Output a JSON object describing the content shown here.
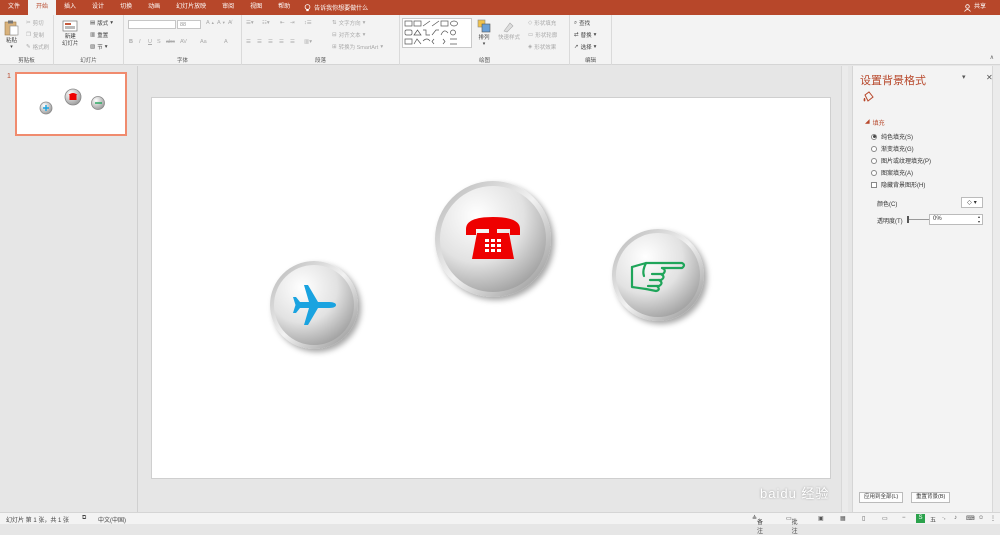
{
  "tabs": [
    {
      "label": "文件",
      "active": false
    },
    {
      "label": "开始",
      "active": true
    },
    {
      "label": "插入",
      "active": false
    },
    {
      "label": "设计",
      "active": false
    },
    {
      "label": "切换",
      "active": false
    },
    {
      "label": "动画",
      "active": false
    },
    {
      "label": "幻灯片放映",
      "active": false
    },
    {
      "label": "审阅",
      "active": false
    },
    {
      "label": "视图",
      "active": false
    },
    {
      "label": "帮助",
      "active": false
    }
  ],
  "tell_me": "告诉我你想要做什么",
  "share": "共享",
  "ribbon": {
    "clipboard": {
      "label": "剪贴板",
      "paste": "粘贴",
      "cut": "剪切",
      "copy": "复制",
      "format_painter": "格式刷"
    },
    "slides": {
      "label": "幻灯片",
      "new_slide": "新建\n幻灯片",
      "layout": "版式",
      "reset": "重置",
      "section": "节"
    },
    "font": {
      "label": "字体",
      "size": "88",
      "bold": "B",
      "italic": "I",
      "underline": "U",
      "shadow": "S",
      "strike": "abc",
      "spacing": "AV",
      "case": "Aa",
      "color": "A"
    },
    "paragraph": {
      "label": "段落",
      "text_direction": "文字方向",
      "align_text": "对齐文本",
      "smartart": "转换为 SmartArt"
    },
    "drawing": {
      "label": "绘图",
      "arrange": "排列",
      "quick_styles": "快速样式",
      "shape_fill": "形状填充",
      "shape_outline": "形状轮廓",
      "shape_effects": "形状效果"
    },
    "editing": {
      "label": "编辑",
      "find": "查找",
      "replace": "替换",
      "select": "选择"
    }
  },
  "thumbs": {
    "slide_number": "1"
  },
  "panel": {
    "title": "设置背景格式",
    "section": "填充",
    "options": [
      "纯色填充(S)",
      "渐变填充(G)",
      "图片或纹理填充(P)",
      "图案填充(A)"
    ],
    "selected_index": 0,
    "hide_bg": "隐藏背景图形(H)",
    "color_label": "颜色(C)",
    "transparency_label": "透明度(T)",
    "transparency_value": "0%",
    "apply_all": "应用到全部(L)",
    "reset_bg": "重置背景(B)"
  },
  "status": {
    "slide": "幻灯片 第 1 张，共 1 张",
    "lang": "中文(中国)",
    "notes": "备注",
    "comments": "批注",
    "ime": "五"
  },
  "watermark": "baidu 经验",
  "icons": {
    "airplane": "airplane-icon",
    "phone": "telephone-icon",
    "pointing_hand": "pointing-hand-icon"
  },
  "colors": {
    "accent": "#b7472a",
    "airplane": "#1aa3e0",
    "phone": "#ee0000",
    "hand": "#1fa55a"
  }
}
